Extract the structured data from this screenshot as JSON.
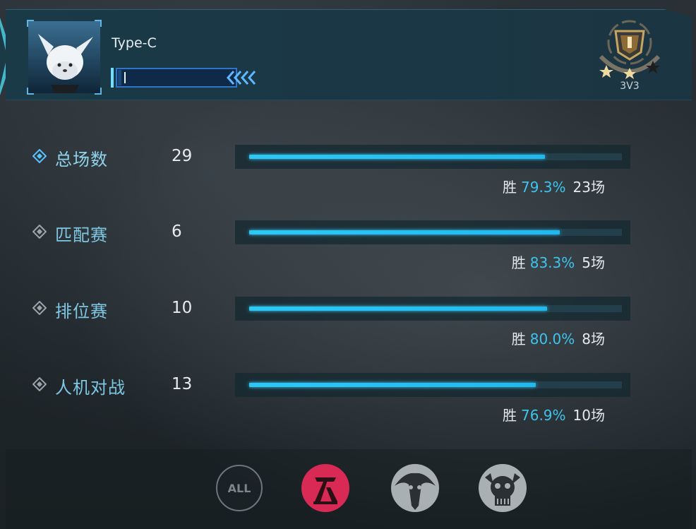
{
  "profile": {
    "name": "Type-C",
    "rank_mode": "3V3",
    "exp_fraction": 0.03
  },
  "stats": [
    {
      "label": "总场数",
      "count": "29",
      "win_label": "胜",
      "win_pct": "79.3%",
      "wins": "23场",
      "win_rate": 0.793,
      "selected": true
    },
    {
      "label": "匹配赛",
      "count": "6",
      "win_label": "胜",
      "win_pct": "83.3%",
      "wins": "5场",
      "win_rate": 0.833,
      "selected": false
    },
    {
      "label": "排位赛",
      "count": "10",
      "win_label": "胜",
      "win_pct": "80.0%",
      "wins": "8场",
      "win_rate": 0.8,
      "selected": false
    },
    {
      "label": "人机对战",
      "count": "13",
      "win_label": "胜",
      "win_pct": "76.9%",
      "wins": "10场",
      "win_rate": 0.769,
      "selected": false
    }
  ],
  "filters": [
    {
      "label": "ALL",
      "icon": "all-icon",
      "active": false
    },
    {
      "label": "",
      "icon": "faction-human-icon",
      "active": true
    },
    {
      "label": "",
      "icon": "faction-beast-icon",
      "active": false
    },
    {
      "label": "",
      "icon": "faction-skull-icon",
      "active": false
    }
  ],
  "colors": {
    "accent": "#2ec8f5",
    "label": "#7ec7e3",
    "active_filter": "#d82a55"
  }
}
